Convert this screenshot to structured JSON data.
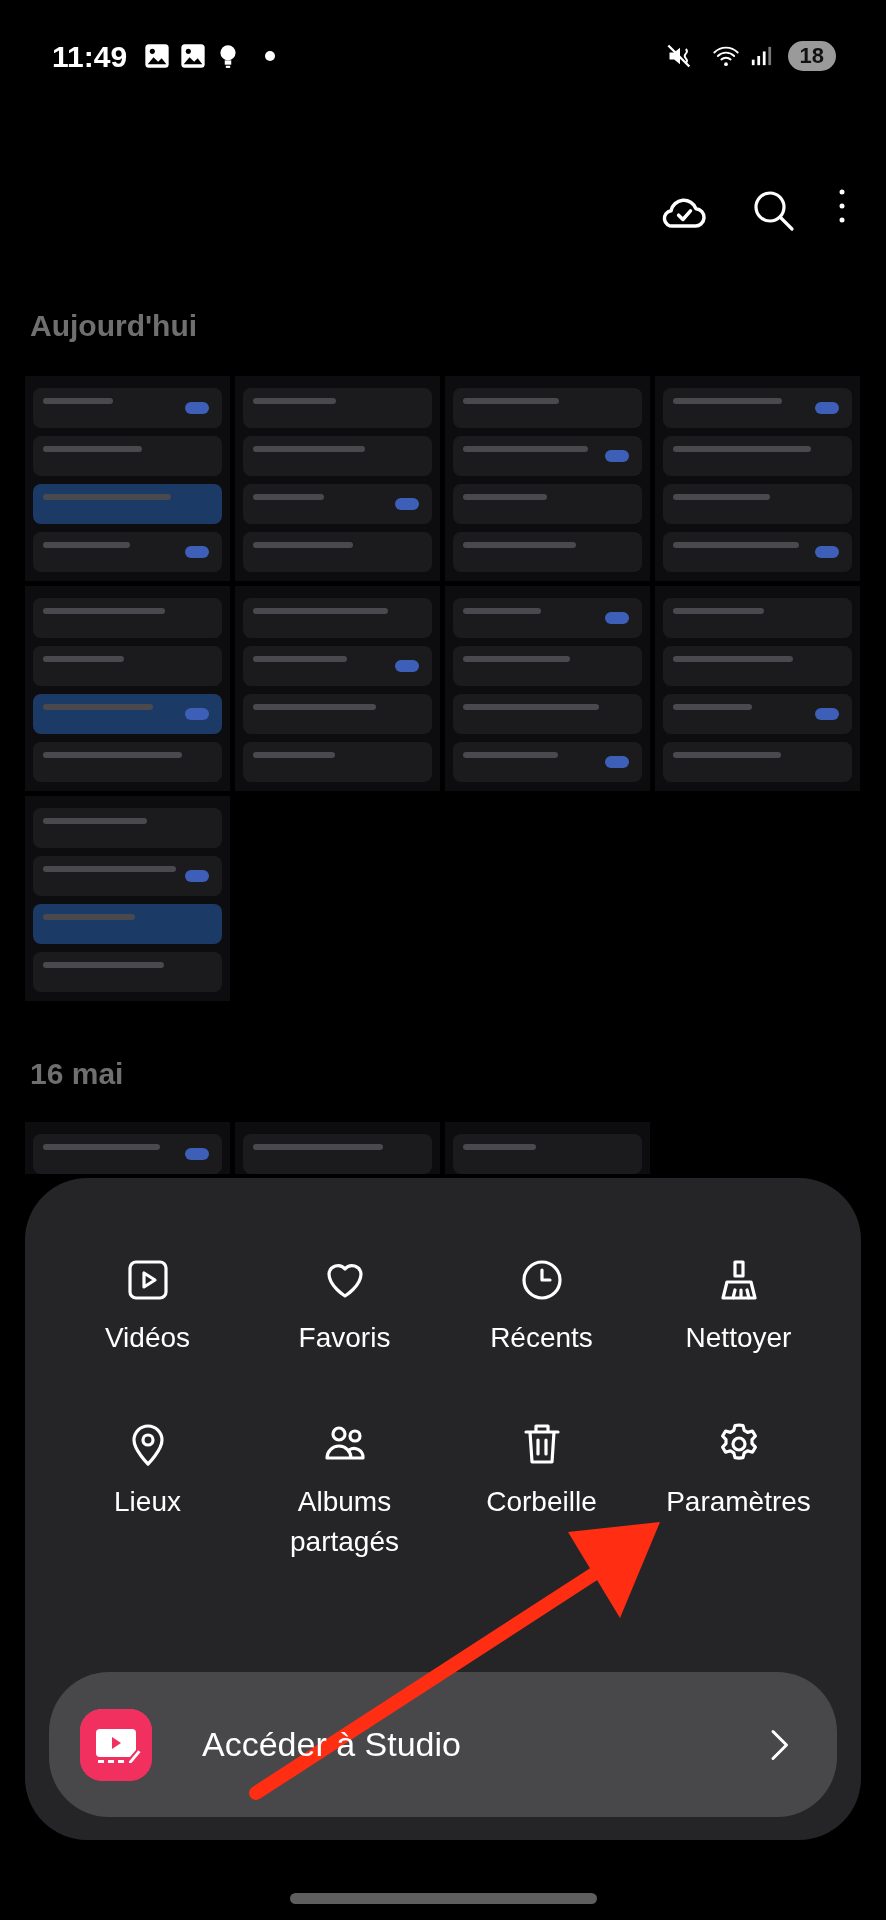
{
  "status_bar": {
    "time": "11:49",
    "battery": "18"
  },
  "sections": [
    {
      "title": "Aujourd'hui"
    },
    {
      "title": "16 mai"
    }
  ],
  "menu": {
    "items": [
      {
        "label": "Vidéos",
        "kind": "video"
      },
      {
        "label": "Favoris",
        "kind": "heart"
      },
      {
        "label": "Récents",
        "kind": "clock"
      },
      {
        "label": "Nettoyer",
        "kind": "broom"
      },
      {
        "label": "Lieux",
        "kind": "pin"
      },
      {
        "label": "Albums partagés",
        "kind": "people"
      },
      {
        "label": "Corbeille",
        "kind": "trash"
      },
      {
        "label": "Paramètres",
        "kind": "gear"
      }
    ],
    "studio_button": {
      "label": "Accéder à Studio"
    }
  }
}
